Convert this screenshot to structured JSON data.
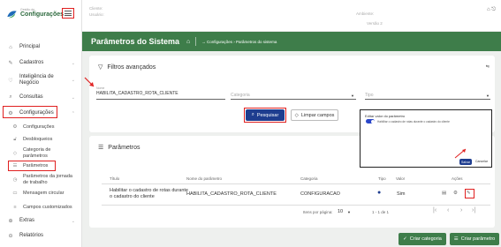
{
  "app": {
    "logo_small": "Gestão de",
    "logo_big": "Configurações"
  },
  "topbar": {
    "cliente_label": "Cliente:",
    "usuario_label": "Usuário:",
    "ambiente_label": "Ambiente:",
    "versao_label": "Versão 2"
  },
  "sidebar": {
    "items": [
      {
        "label": "Principal",
        "icon": "home-icon"
      },
      {
        "label": "Cadastros",
        "icon": "edit-icon"
      },
      {
        "label": "Inteligência de Negócio",
        "icon": "bulb-icon"
      },
      {
        "label": "Consultas",
        "icon": "search-icon"
      },
      {
        "label": "Configurações",
        "icon": "gear-icon"
      }
    ],
    "subitems": [
      {
        "label": "Configurações",
        "icon": "gear-icon"
      },
      {
        "label": "Desbloqueios",
        "icon": "unlock-icon"
      },
      {
        "label": "Categoria de parâmetros",
        "icon": "tag-icon"
      },
      {
        "label": "Parâmetros",
        "icon": "list-icon"
      },
      {
        "label": "Parâmetros da jornada de trabalho",
        "icon": "clock-icon"
      },
      {
        "label": "Mensagem circular",
        "icon": "message-icon"
      },
      {
        "label": "Campos customizados",
        "icon": "fields-icon"
      }
    ],
    "extra_items": [
      {
        "label": "Extras",
        "icon": "plus-circle-icon"
      },
      {
        "label": "Relatórios",
        "icon": "report-icon"
      }
    ]
  },
  "header": {
    "title": "Parâmetros do Sistema",
    "breadcrumb": "→ Configurações › Parâmetros do sistema"
  },
  "filters": {
    "title": "Filtros avançados",
    "name_label": "Nome",
    "name_value": "HABILITA_CADASTRO_ROTA_CLIENTE",
    "category_placeholder": "Categoria",
    "type_placeholder": "Tipo",
    "search_button": "Pesquisar",
    "clear_button": "Limpar campos"
  },
  "params": {
    "title": "Parâmetros",
    "columns": [
      "Título",
      "Nome do parâmetro",
      "Categoria",
      "Tipo",
      "Valor",
      "Ações"
    ],
    "rows": [
      {
        "titulo": "Habilitar o cadastro de rotas durante o cadastro do cliente",
        "nome": "HABILITA_CADASTRO_ROTA_CLIENTE",
        "categoria": "CONFIGURACAO",
        "valor": "Sim"
      }
    ],
    "pagination": {
      "per_page_label": "Itens por página:",
      "per_page": "10",
      "range": "1 - 1 de 1"
    }
  },
  "popup": {
    "title": "Editar valor do parâmetro",
    "toggle_label": "Habilitar o cadastro de rotas durante o cadastro do cliente",
    "save": "Salvar",
    "cancel": "Cancelar"
  },
  "bottom": {
    "create_category": "Criar categoria",
    "create_param": "Criar parâmetro"
  },
  "colors": {
    "brand_green": "#3e7d4a",
    "primary_blue": "#1e3d8f",
    "highlight_red": "#e02020"
  }
}
